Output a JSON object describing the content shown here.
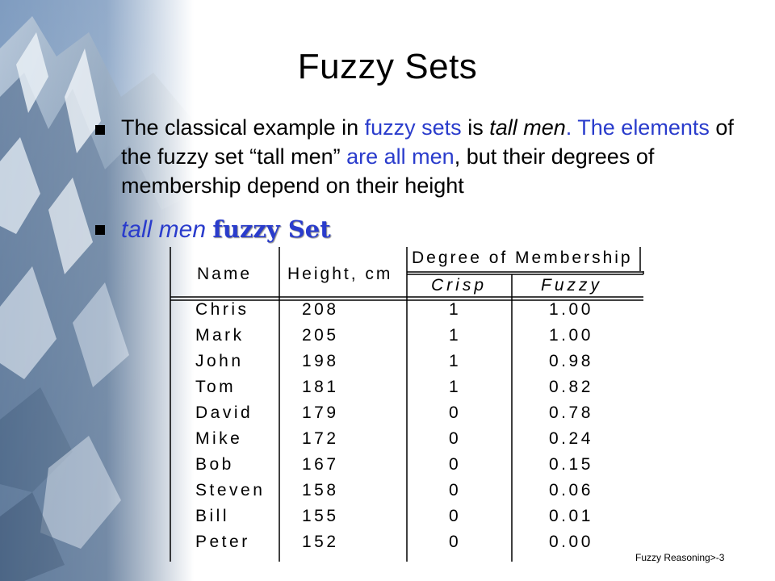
{
  "title": "Fuzzy Sets",
  "bullet1": {
    "parts": [
      "The classical example in ",
      "fuzzy sets",
      " is ",
      "tall men",
      ".  The ",
      "elements",
      " of the fuzzy set “tall men” ",
      "are all men",
      ", but their degrees of membership depend on their height"
    ]
  },
  "bullet2": {
    "italic": "tall men ",
    "bold": "fuzzy Set"
  },
  "table": {
    "header": {
      "name": "Name",
      "height": "Height, cm",
      "degree": "Degree of Membership",
      "crisp": "Crisp",
      "fuzzy": "Fuzzy"
    },
    "rows": [
      {
        "name": "Chris",
        "height": "208",
        "crisp": "1",
        "fuzzy": "1.00"
      },
      {
        "name": "Mark",
        "height": "205",
        "crisp": "1",
        "fuzzy": "1.00"
      },
      {
        "name": "John",
        "height": "198",
        "crisp": "1",
        "fuzzy": "0.98"
      },
      {
        "name": "Tom",
        "height": "181",
        "crisp": "1",
        "fuzzy": "0.82"
      },
      {
        "name": "David",
        "height": "179",
        "crisp": "0",
        "fuzzy": "0.78"
      },
      {
        "name": "Mike",
        "height": "172",
        "crisp": "0",
        "fuzzy": "0.24"
      },
      {
        "name": "Bob",
        "height": "167",
        "crisp": "0",
        "fuzzy": "0.15"
      },
      {
        "name": "Steven",
        "height": "158",
        "crisp": "0",
        "fuzzy": "0.06"
      },
      {
        "name": "Bill",
        "height": "155",
        "crisp": "0",
        "fuzzy": "0.01"
      },
      {
        "name": "Peter",
        "height": "152",
        "crisp": "0",
        "fuzzy": "0.00"
      }
    ]
  },
  "footer": "Fuzzy Reasoning>-3",
  "colors": {
    "accent_blue": "#2a3ccc",
    "text": "#000000"
  }
}
